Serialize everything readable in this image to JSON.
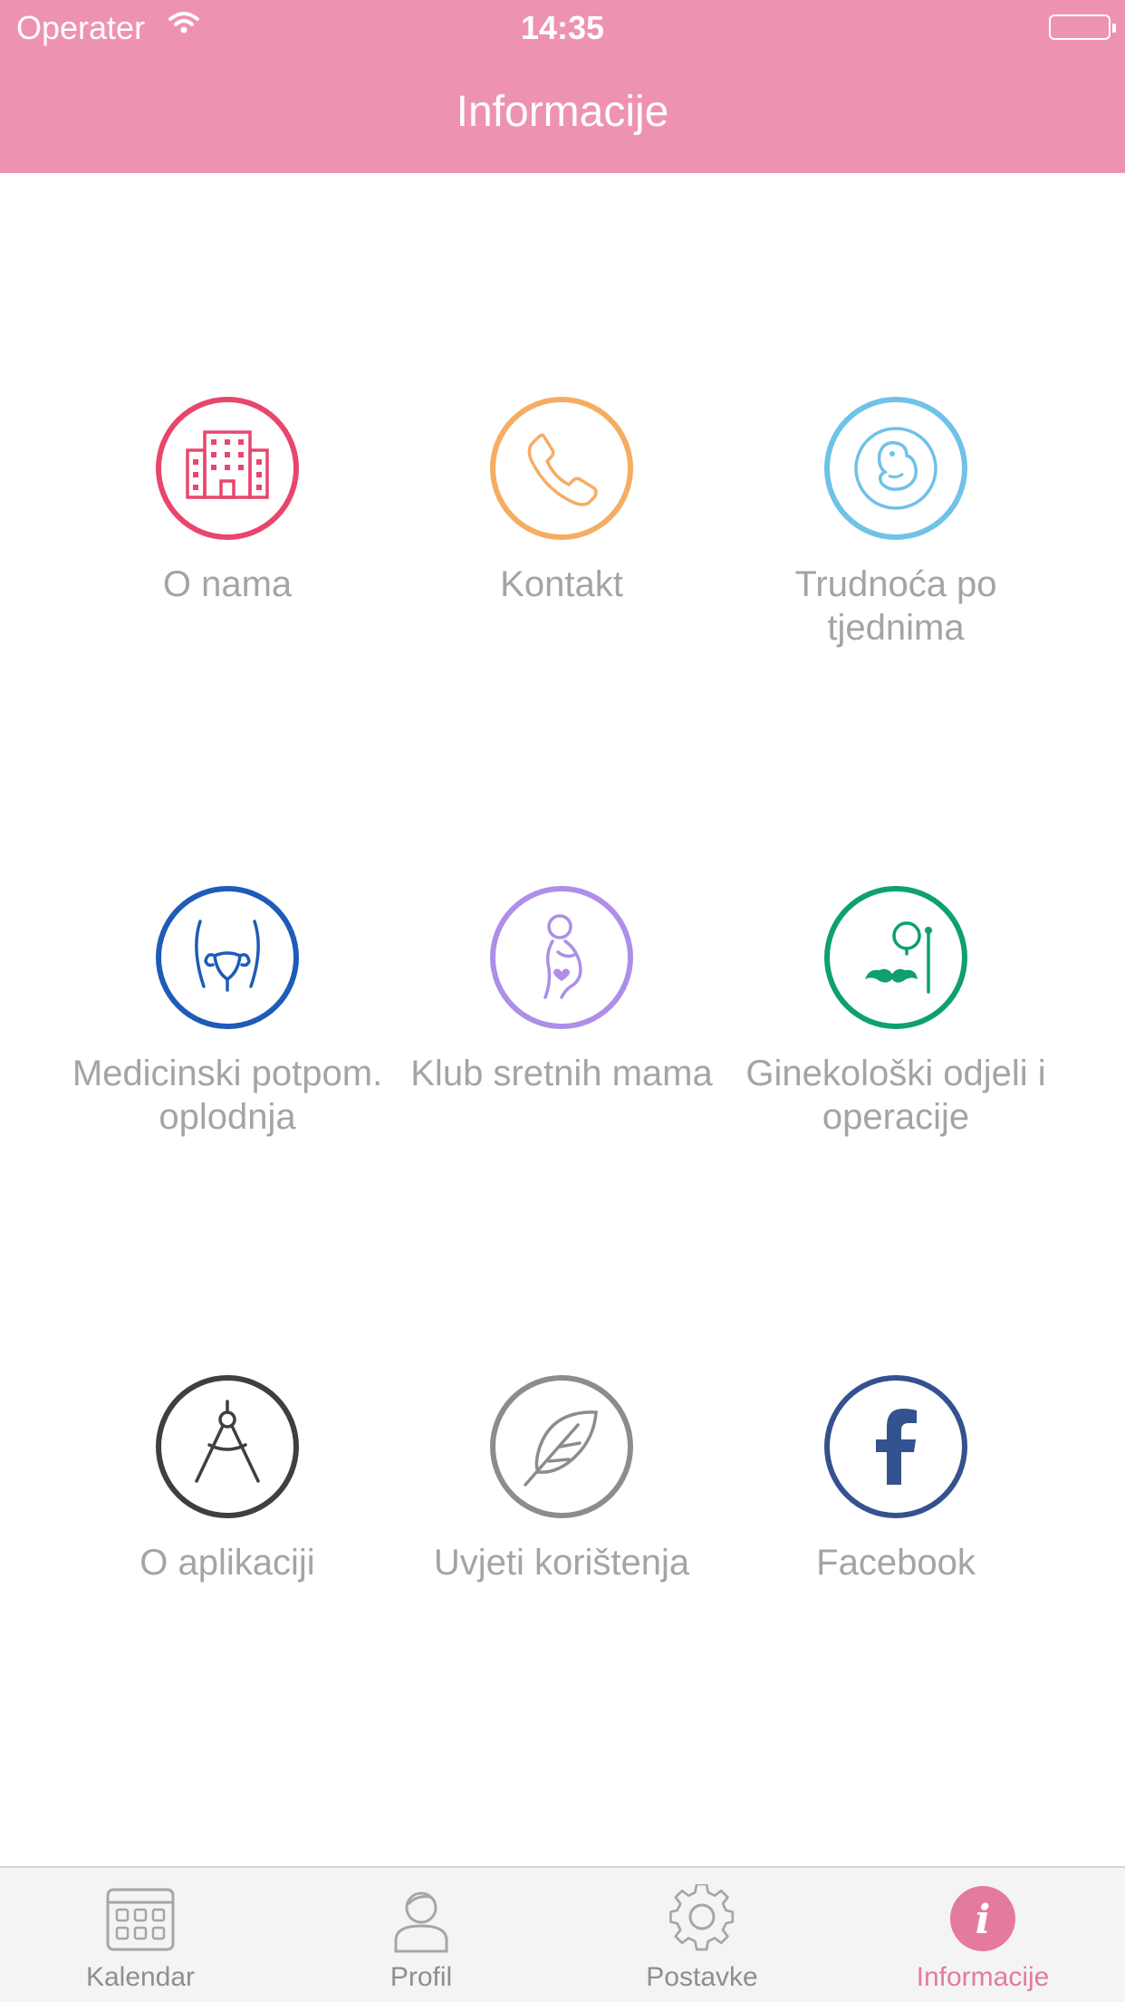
{
  "status_bar": {
    "carrier": "Operater",
    "time": "14:35"
  },
  "header": {
    "title": "Informacije"
  },
  "grid": {
    "items": [
      {
        "label": "O nama",
        "icon": "building-icon",
        "color": "#e8466c"
      },
      {
        "label": "Kontakt",
        "icon": "phone-icon",
        "color": "#f5ad63"
      },
      {
        "label": "Trudnoća po tjednima",
        "icon": "fetus-icon",
        "color": "#6fc2e8"
      },
      {
        "label": "Medicinski potpom. oplodnja",
        "icon": "uterus-icon",
        "color": "#1f5bb9"
      },
      {
        "label": "Klub sretnih mama",
        "icon": "pregnant-mother-icon",
        "color": "#ae8ee8"
      },
      {
        "label": "Ginekološki odjeli i operacije",
        "icon": "doctor-monocle-icon",
        "color": "#0ea06e"
      },
      {
        "label": "O aplikaciji",
        "icon": "compass-icon",
        "color": "#3f3f3f"
      },
      {
        "label": "Uvjeti korištenja",
        "icon": "quill-feather-icon",
        "color": "#8c8c8c"
      },
      {
        "label": "Facebook",
        "icon": "facebook-icon",
        "color": "#34528f"
      }
    ]
  },
  "tabbar": {
    "tabs": [
      {
        "label": "Kalendar",
        "icon": "calendar-icon",
        "active": false
      },
      {
        "label": "Profil",
        "icon": "profile-icon",
        "active": false
      },
      {
        "label": "Postavke",
        "icon": "gear-icon",
        "active": false
      },
      {
        "label": "Informacije",
        "icon": "info-icon",
        "active": true
      }
    ],
    "active_color": "#e47aa0",
    "inactive_color": "#8e8e8e"
  }
}
